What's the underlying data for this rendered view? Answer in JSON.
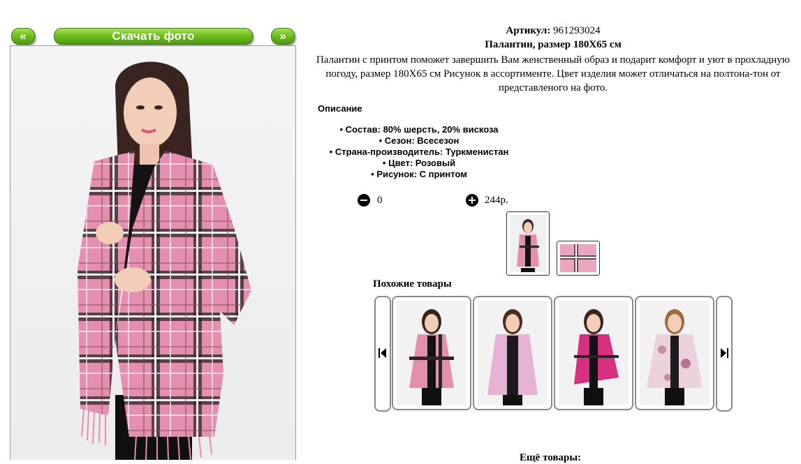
{
  "nav": {
    "prev_label": "«",
    "download_label": "Скачать фото",
    "next_label": "»"
  },
  "product": {
    "article_label": "Артикул:",
    "article_value": "961293024",
    "title": "Палантин, размер 180Х65 см",
    "description": "Палантин с принтом поможет завершить Вам женственный образ и подарит комфорт и уют в прохладную погоду, размер 180Х65 см Рисунок в ассортименте. Цвет изделия может отличаться на полтона-тон от представленого на фото."
  },
  "description_heading": "Описание",
  "properties": [
    "Состав: 80% шерсть, 20% вискоза",
    "Сезон: Всесезон",
    "Страна-производитель: Туркменистан",
    "Цвет: Розовый",
    "Рисунок: С принтом"
  ],
  "order": {
    "quantity": "0",
    "price": "244р."
  },
  "similar_heading": "Похожие товары",
  "more_heading": "Ещё товары:",
  "colors": {
    "nav_green": "#6fbf1f",
    "scarf_pink": "#e58fb0",
    "scarf_magenta": "#d6307f"
  }
}
